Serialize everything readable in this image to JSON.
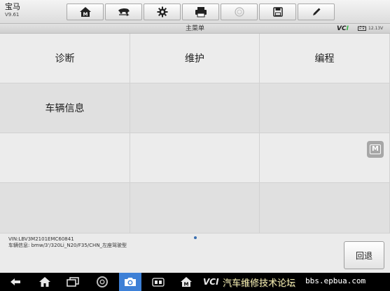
{
  "app": {
    "title": "宝马",
    "version": "V9.61"
  },
  "toolbar": {
    "buttons": [
      {
        "name": "home-m",
        "icon": "home-m-icon"
      },
      {
        "name": "vehicle-swap",
        "icon": "car-swap-icon"
      },
      {
        "name": "settings",
        "icon": "gear-icon"
      },
      {
        "name": "print",
        "icon": "printer-icon"
      },
      {
        "name": "help",
        "icon": "help-icon",
        "disabled": true
      },
      {
        "name": "save",
        "icon": "floppy-save-icon"
      },
      {
        "name": "edit",
        "icon": "pen-icon"
      }
    ]
  },
  "subbar": {
    "menu_title": "主菜单",
    "vci_logo": "VCI",
    "voltage": "12.13V"
  },
  "menu": {
    "items": [
      "诊断",
      "维护",
      "编程",
      "车辆信息",
      "",
      "",
      "",
      "",
      "",
      "",
      "",
      ""
    ]
  },
  "footer": {
    "vin": "VIN:LBV3M2101EMC60841",
    "vehicle_info": "车辆信息: bmw/3'/320Li_N20/F35/CHN_左座驾驶型",
    "back_label": "回退"
  },
  "navbar": {
    "vci_label": "VCI",
    "watermark_zh": "汽车维修技术论坛",
    "watermark_en": "bbs.epbua.com"
  },
  "colors": {
    "accent_blue": "#3e80d6",
    "vci_green": "#39b54a",
    "grid_bg": "#ececec"
  }
}
